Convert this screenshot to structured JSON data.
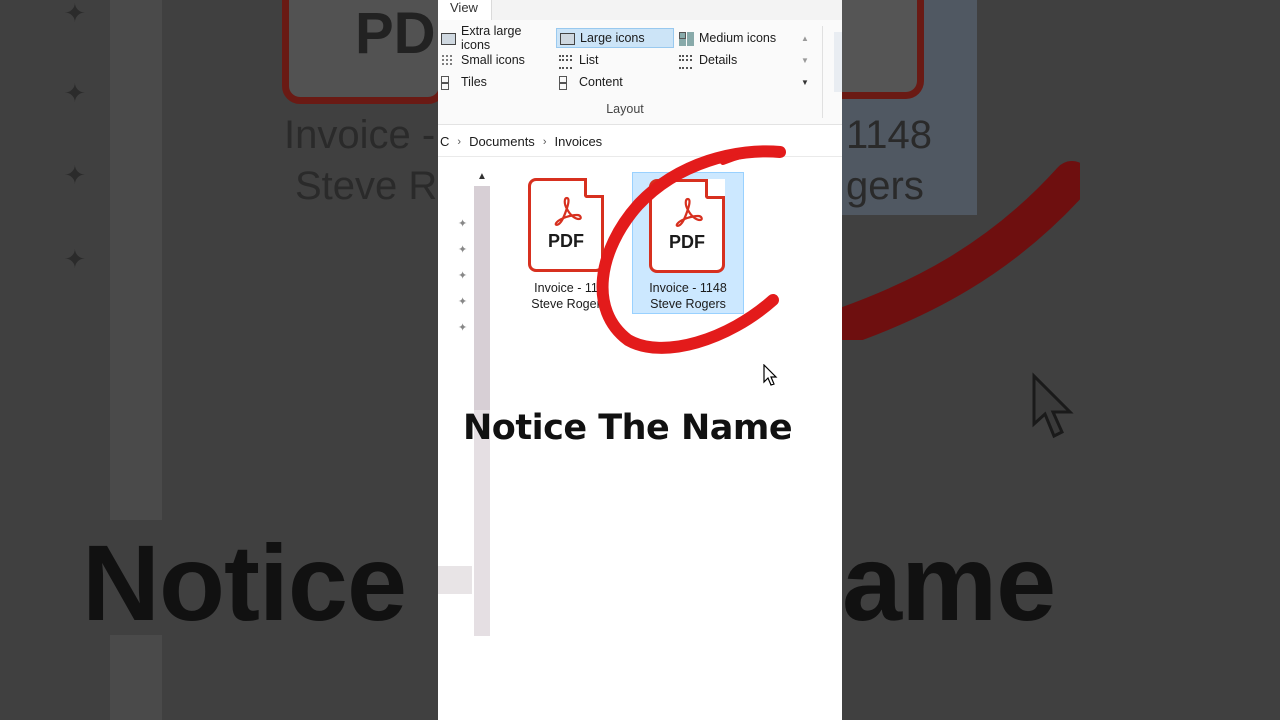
{
  "ribbon": {
    "active_tab": "View",
    "layout_options": [
      {
        "label": "Extra large icons",
        "icon": "extra-large-icons-icon"
      },
      {
        "label": "Large icons",
        "icon": "large-icons-icon",
        "selected": true
      },
      {
        "label": "Medium icons",
        "icon": "medium-icons-icon"
      },
      {
        "label": "Small icons",
        "icon": "small-icons-icon"
      },
      {
        "label": "List",
        "icon": "list-icon"
      },
      {
        "label": "Details",
        "icon": "details-icon"
      },
      {
        "label": "Tiles",
        "icon": "tiles-icon"
      },
      {
        "label": "Content",
        "icon": "content-icon"
      }
    ],
    "group_label": "Layout"
  },
  "address_bar": {
    "crumbs": [
      "C",
      "Documents",
      "Invoices"
    ]
  },
  "files": [
    {
      "icon_text": "PDF",
      "name_line1": "Invoice - 11",
      "name_line2": "Steve Roger",
      "selected": false
    },
    {
      "icon_text": "PDF",
      "name_line1": "Invoice - 1148",
      "name_line2": "Steve Rogers",
      "selected": true
    }
  ],
  "caption": "Notice The Name",
  "background": {
    "pdf_text": "PDF",
    "label_left_1": "Invoice -",
    "label_left_2": "Steve Ro",
    "label_right_1": "1148",
    "label_right_2": "gers",
    "big_left": "Notice",
    "big_right": "ame"
  },
  "colors": {
    "pdf_red": "#d7301f",
    "annotation_red": "#e31b1b",
    "selection_blue": "#cce8ff"
  }
}
